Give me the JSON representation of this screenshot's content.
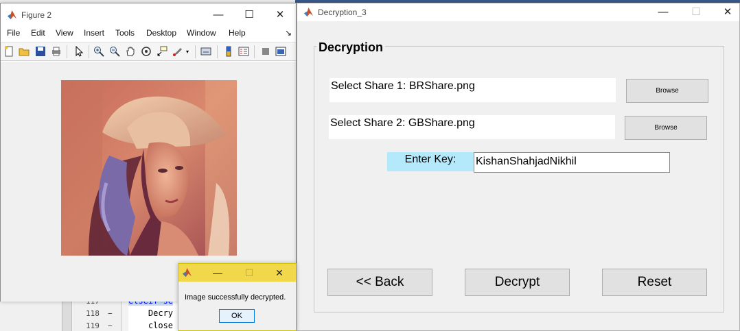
{
  "editor": {
    "lines": [
      {
        "num": "117",
        "mark": "−",
        "code": "elseif se"
      },
      {
        "num": "118",
        "mark": "−",
        "code": "    Decry"
      },
      {
        "num": "119",
        "mark": "−",
        "code": "    close"
      }
    ]
  },
  "figure": {
    "title": "Figure 2",
    "menu": [
      "File",
      "Edit",
      "View",
      "Insert",
      "Tools",
      "Desktop",
      "Window",
      "Help"
    ],
    "menu_arrow": "↘"
  },
  "decryption": {
    "title": "Decryption_3",
    "panel_title": "Decryption",
    "share1_label": "Select Share 1: BRShare.png",
    "share2_label": "Select Share 2: GBShare.png",
    "browse_label": "Browse",
    "key_label": "Enter Key:",
    "key_value": "KishanShahjadNikhil",
    "back_label": "<< Back",
    "decrypt_label": "Decrypt",
    "reset_label": "Reset"
  },
  "message": {
    "text": "Image successfully decrypted.",
    "ok_label": "OK"
  },
  "window_controls": {
    "minimize": "—",
    "maximize": "☐",
    "close": "✕"
  },
  "colors": {
    "key_label_bg": "#b4e9fc",
    "msg_title_bg": "#f0d84a",
    "ok_border": "#0078d7"
  }
}
